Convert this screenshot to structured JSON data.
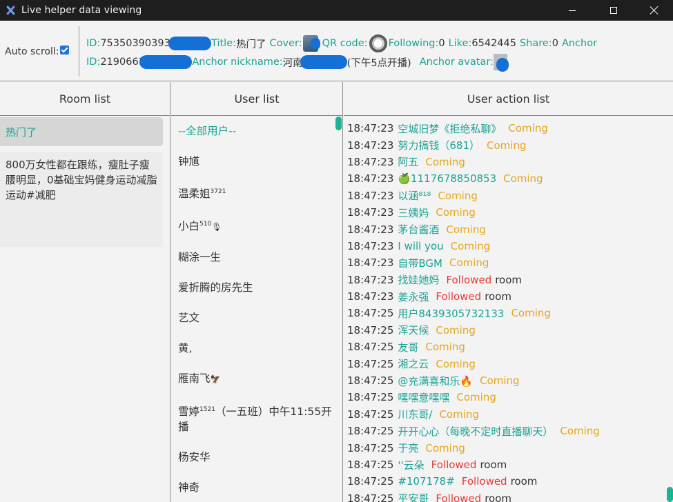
{
  "window": {
    "title": "Live helper data viewing"
  },
  "info": {
    "auto_scroll_label": "Auto scroll:",
    "id_label": "ID:",
    "room_id": "753503903931",
    "title_label": "Title:",
    "title": "热门了",
    "cover_label": "Cover:",
    "qr_label": "QR code:",
    "following_label": "Following:",
    "following": "0",
    "like_label": "Like:",
    "like": "6542445",
    "share_label": "Share:",
    "share": "0",
    "anchor_label": "Anchor",
    "anchor_id_label": "ID:",
    "anchor_id": "219066196",
    "anchor_nickname_label": "Anchor nickname:",
    "anchor_nickname_prefix": "河南",
    "anchor_nickname_suffix": "(下午5点开播)",
    "anchor_avatar_label": "Anchor avatar:"
  },
  "rooms": {
    "header": "Room list",
    "items": [
      {
        "label": "热门了"
      },
      {
        "label": "800万女性都在跟练，瘦肚子瘦腰明显，0基础宝妈健身运动减脂运动#减肥"
      }
    ]
  },
  "users": {
    "header": "User list",
    "items": [
      {
        "name": "--全部用户--"
      },
      {
        "name": "钟馗"
      },
      {
        "name": "温柔姐",
        "sup": "3721"
      },
      {
        "name": "小白",
        "sup": "510",
        "icon": "🎙"
      },
      {
        "name": "糊涂一生"
      },
      {
        "name": "爱折腾的房先生"
      },
      {
        "name": "艺文"
      },
      {
        "name": "黄,"
      },
      {
        "name": "雁南飞",
        "icon": "🦅"
      },
      {
        "name": "雪婷",
        "sup": "1521",
        "extra": "（一五班）中午11:55开播"
      },
      {
        "name": "杨安华"
      },
      {
        "name": "神奇"
      }
    ]
  },
  "actions": {
    "header": "User action list",
    "items": [
      {
        "time": "18:47:23",
        "user": "空城旧梦《拒绝私聊》",
        "action": "Coming"
      },
      {
        "time": "18:47:23",
        "user": "努力搞钱（681）",
        "action": "Coming"
      },
      {
        "time": "18:47:23",
        "user": "阿五",
        "action": "Coming"
      },
      {
        "time": "18:47:23",
        "user": "🍏1117678850853",
        "action": "Coming"
      },
      {
        "time": "18:47:23",
        "user": "以涵⁸¹⁸",
        "action": "Coming"
      },
      {
        "time": "18:47:23",
        "user": "三姨妈",
        "action": "Coming"
      },
      {
        "time": "18:47:23",
        "user": "茅台酱酒",
        "action": "Coming"
      },
      {
        "time": "18:47:23",
        "user": "I will you",
        "action": "Coming"
      },
      {
        "time": "18:47:23",
        "user": "自带BGM",
        "action": "Coming"
      },
      {
        "time": "18:47:23",
        "user": "找娃她妈",
        "action": "Followed",
        "suffix": "room"
      },
      {
        "time": "18:47:23",
        "user": "姜永强",
        "action": "Followed",
        "suffix": "room"
      },
      {
        "time": "18:47:25",
        "user": "用户8439305732133",
        "action": "Coming"
      },
      {
        "time": "18:47:25",
        "user": "浑天候",
        "action": "Coming"
      },
      {
        "time": "18:47:25",
        "user": "友哥",
        "action": "Coming"
      },
      {
        "time": "18:47:25",
        "user": "湘之云",
        "action": "Coming"
      },
      {
        "time": "18:47:25",
        "user": "@充满喜和乐🔥",
        "action": "Coming"
      },
      {
        "time": "18:47:25",
        "user": "嘿嘿意嘿嘿",
        "action": "Coming"
      },
      {
        "time": "18:47:25",
        "user": "川东哥/",
        "action": "Coming"
      },
      {
        "time": "18:47:25",
        "user": "开开心心（每晚不定时直播聊天）",
        "action": "Coming"
      },
      {
        "time": "18:47:25",
        "user": "于亮",
        "action": "Coming"
      },
      {
        "time": "18:47:25",
        "user": "''云朵",
        "action": "Followed",
        "suffix": "room"
      },
      {
        "time": "18:47:25",
        "user": "#107178#",
        "action": "Followed",
        "suffix": "room"
      },
      {
        "time": "18:47:25",
        "user": "平安哥",
        "action": "Followed",
        "suffix": "room"
      }
    ]
  }
}
